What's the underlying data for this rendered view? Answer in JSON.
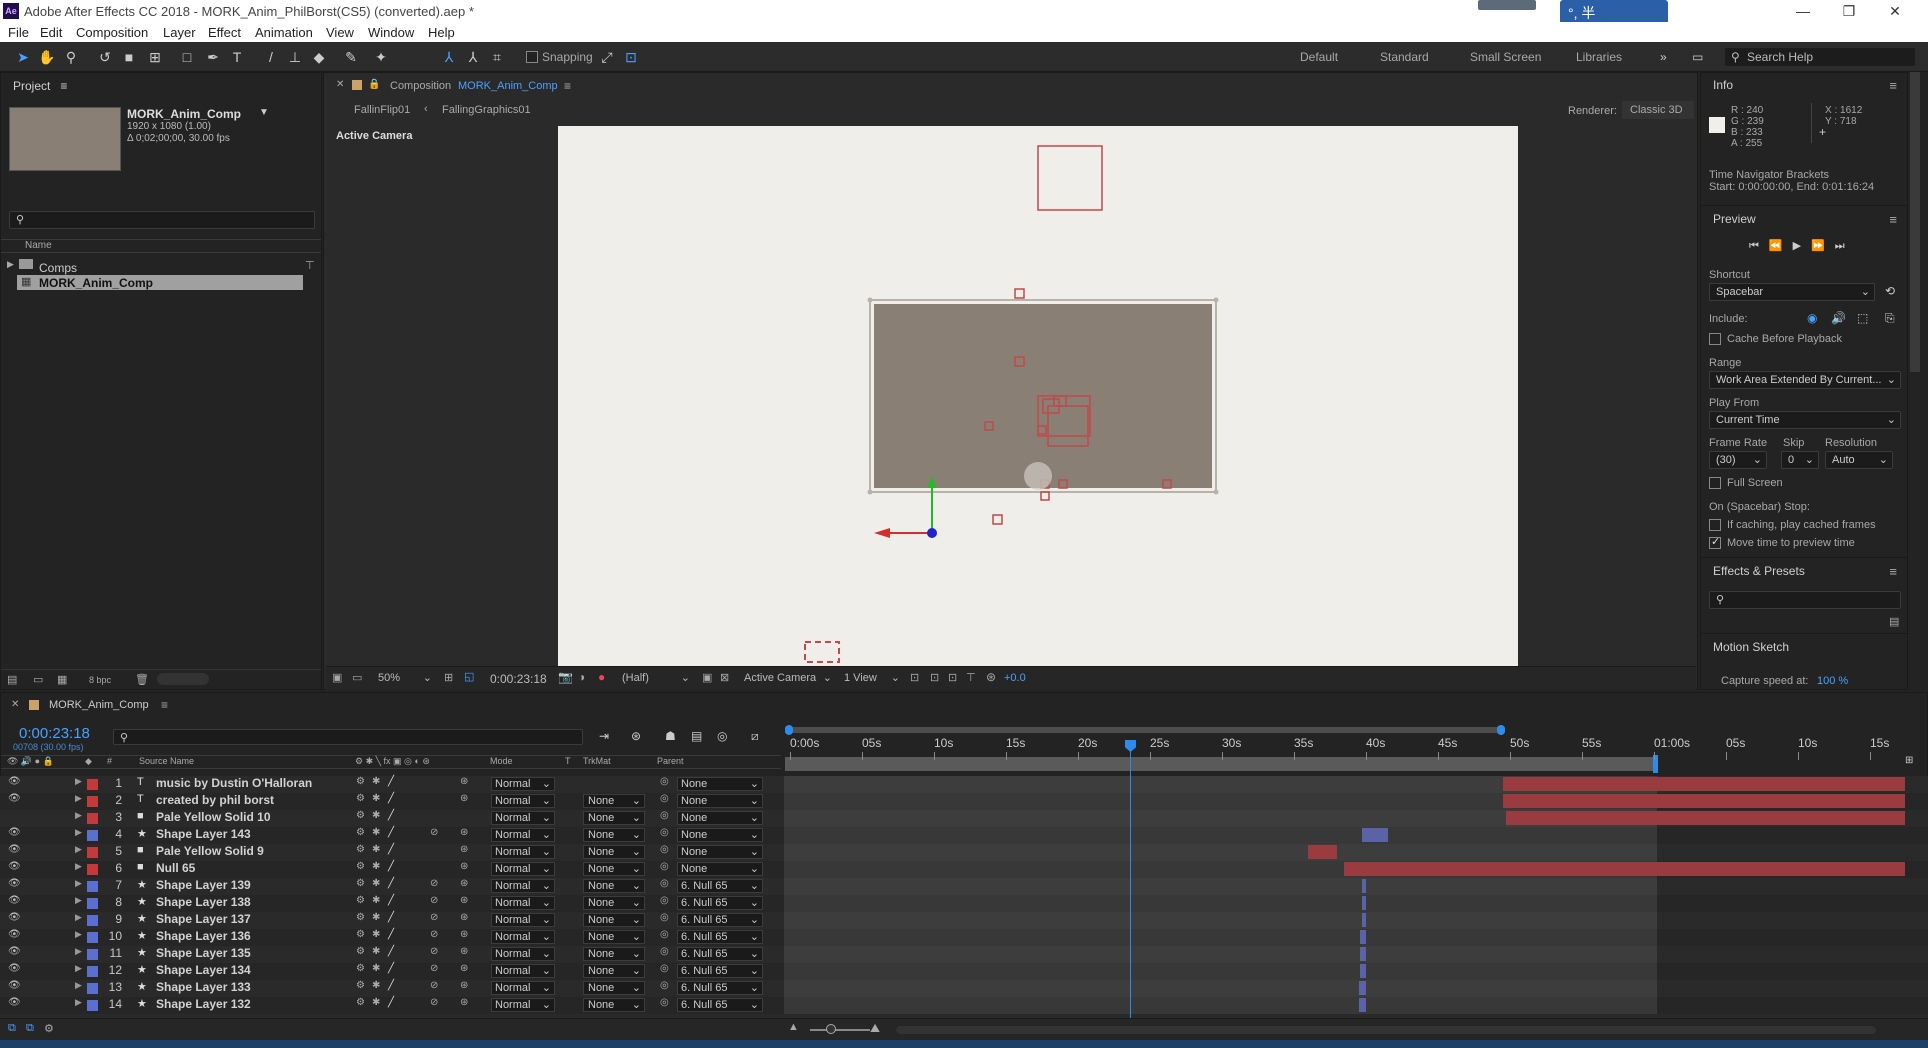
{
  "window": {
    "title": "Adobe After Effects CC 2018 - MORK_Anim_PhilBorst(CS5) (converted).aep *",
    "app_icon": "Ae",
    "ime_text": "°, 半"
  },
  "menu": [
    "File",
    "Edit",
    "Composition",
    "Layer",
    "Effect",
    "Animation",
    "View",
    "Window",
    "Help"
  ],
  "toolbar": {
    "snapping": "Snapping",
    "workspaces": [
      "Default",
      "Standard",
      "Small Screen",
      "Libraries"
    ],
    "search_help": "Search Help"
  },
  "project": {
    "title": "Project",
    "comp_name": "MORK_Anim_Comp",
    "dims": "1920 x 1080 (1.00)",
    "duration": "Δ 0;02;00;00, 30.00 fps",
    "name_col": "Name",
    "folder": "Comps",
    "selected_item": "MORK_Anim_Comp",
    "bpc": "8 bpc"
  },
  "composition": {
    "tab_prefix": "Composition",
    "tab_name": "MORK_Anim_Comp",
    "breadcrumb1": "FallinFlip01",
    "breadcrumb2": "FallingGraphics01",
    "renderer_label": "Renderer:",
    "renderer": "Classic 3D",
    "camera_label": "Active Camera",
    "zoom": "50%",
    "timecode": "0:00:23:18",
    "resolution": "(Half)",
    "view_camera": "Active Camera",
    "views": "1 View",
    "exposure": "+0.0"
  },
  "info": {
    "title": "Info",
    "r": "R : 240",
    "g": "G : 239",
    "b": "B : 233",
    "a": "A : 255",
    "x": "X : 1612",
    "y": "Y : 718",
    "line1": "Time Navigator Brackets",
    "line2": "Start: 0:00:00:00, End: 0:01:16:24"
  },
  "preview": {
    "title": "Preview",
    "shortcut_label": "Shortcut",
    "shortcut": "Spacebar",
    "include_label": "Include:",
    "cache_label": "Cache Before Playback",
    "range_label": "Range",
    "range": "Work Area Extended By Current...",
    "playfrom_label": "Play From",
    "playfrom": "Current Time",
    "fr_label": "Frame Rate",
    "skip_label": "Skip",
    "res_label": "Resolution",
    "fr": "(30)",
    "skip": "0",
    "res": "Auto",
    "fullscreen": "Full Screen",
    "stop_label": "On (Spacebar) Stop:",
    "stop1": "If caching, play cached frames",
    "stop2": "Move time to preview time"
  },
  "effects": {
    "title": "Effects & Presets"
  },
  "motion": {
    "title": "Motion Sketch",
    "capture_label": "Capture speed at:",
    "capture_value": "100 %"
  },
  "timeline": {
    "comp_tab": "MORK_Anim_Comp",
    "timecode": "0:00:23:18",
    "frames": "00708 (30.00 fps)",
    "col_num": "#",
    "col_source": "Source Name",
    "col_mode": "Mode",
    "col_t": "T",
    "col_trkmat": "TrkMat",
    "col_parent": "Parent",
    "ticks": [
      "0:00s",
      "05s",
      "10s",
      "15s",
      "20s",
      "25s",
      "30s",
      "35s",
      "40s",
      "45s",
      "50s",
      "55s",
      "01:00s",
      "05s",
      "10s",
      "15s"
    ],
    "layers": [
      {
        "num": "1",
        "icon": "T",
        "name": "music by Dustin O'Halloran",
        "color": "#c23a3a",
        "mode": "Normal",
        "trk": "",
        "parent": "None"
      },
      {
        "num": "2",
        "icon": "T",
        "name": "created by phil borst",
        "color": "#c23a3a",
        "mode": "Normal",
        "trk": "None",
        "parent": "None"
      },
      {
        "num": "3",
        "icon": "■",
        "name": "Pale Yellow Solid 10",
        "color": "#c23a3a",
        "mode": "Normal",
        "trk": "None",
        "parent": "None"
      },
      {
        "num": "4",
        "icon": "★",
        "name": "Shape Layer 143",
        "color": "#5a6fd0",
        "mode": "Normal",
        "trk": "None",
        "parent": "None"
      },
      {
        "num": "5",
        "icon": "■",
        "name": "Pale Yellow Solid 9",
        "color": "#c23a3a",
        "mode": "Normal",
        "trk": "None",
        "parent": "None"
      },
      {
        "num": "6",
        "icon": "■",
        "name": "Null 65",
        "color": "#c23a3a",
        "mode": "Normal",
        "trk": "None",
        "parent": "None"
      },
      {
        "num": "7",
        "icon": "★",
        "name": "Shape Layer 139",
        "color": "#5a6fd0",
        "mode": "Normal",
        "trk": "None",
        "parent": "6. Null 65"
      },
      {
        "num": "8",
        "icon": "★",
        "name": "Shape Layer 138",
        "color": "#5a6fd0",
        "mode": "Normal",
        "trk": "None",
        "parent": "6. Null 65"
      },
      {
        "num": "9",
        "icon": "★",
        "name": "Shape Layer 137",
        "color": "#5a6fd0",
        "mode": "Normal",
        "trk": "None",
        "parent": "6. Null 65"
      },
      {
        "num": "10",
        "icon": "★",
        "name": "Shape Layer 136",
        "color": "#5a6fd0",
        "mode": "Normal",
        "trk": "None",
        "parent": "6. Null 65"
      },
      {
        "num": "11",
        "icon": "★",
        "name": "Shape Layer 135",
        "color": "#5a6fd0",
        "mode": "Normal",
        "trk": "None",
        "parent": "6. Null 65"
      },
      {
        "num": "12",
        "icon": "★",
        "name": "Shape Layer 134",
        "color": "#5a6fd0",
        "mode": "Normal",
        "trk": "None",
        "parent": "6. Null 65"
      },
      {
        "num": "13",
        "icon": "★",
        "name": "Shape Layer 133",
        "color": "#5a6fd0",
        "mode": "Normal",
        "trk": "None",
        "parent": "6. Null 65"
      },
      {
        "num": "14",
        "icon": "★",
        "name": "Shape Layer 132",
        "color": "#5a6fd0",
        "mode": "Normal",
        "trk": "None",
        "parent": "6. Null 65"
      }
    ]
  },
  "colors": {
    "accent": "#2d8ceb",
    "label_red": "#c23a3a",
    "label_blue": "#5a6fd0",
    "bar_red": "#9a3b3f",
    "bar_blue": "#5a62a8",
    "frame_bg": "#efeeea",
    "thumb": "#8a7f74"
  }
}
